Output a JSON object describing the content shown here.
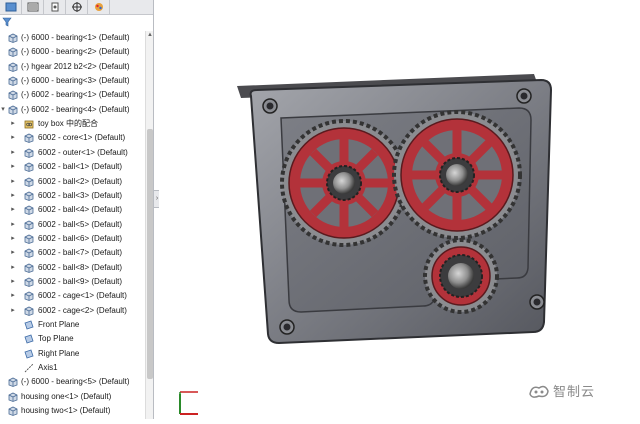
{
  "tree": {
    "items": [
      {
        "label": "(-) 6000 - bearing<1> (Default)",
        "icon": "part-icon",
        "level": 0,
        "arrow": ""
      },
      {
        "label": "(-) 6000 - bearing<2> (Default)",
        "icon": "part-icon",
        "level": 0,
        "arrow": ""
      },
      {
        "label": "(-) hgear 2012 b2<2> (Default)",
        "icon": "part-icon",
        "level": 0,
        "arrow": ""
      },
      {
        "label": "(-) 6000 - bearing<3> (Default)",
        "icon": "part-icon",
        "level": 0,
        "arrow": ""
      },
      {
        "label": "(-) 6002 - bearing<1> (Default)",
        "icon": "part-icon",
        "level": 0,
        "arrow": ""
      },
      {
        "label": "(-) 6002 - bearing<4> (Default)",
        "icon": "part-icon",
        "level": 0,
        "arrow": "v"
      },
      {
        "label": "toy box 中的配合",
        "icon": "mates-folder-icon",
        "level": 1,
        "arrow": ">"
      },
      {
        "label": "6002 - core<1> (Default)",
        "icon": "part-icon",
        "level": 1,
        "arrow": ">"
      },
      {
        "label": "6002 - outer<1> (Default)",
        "icon": "part-icon",
        "level": 1,
        "arrow": ">"
      },
      {
        "label": "6002 - ball<1> (Default)",
        "icon": "part-icon",
        "level": 1,
        "arrow": ">"
      },
      {
        "label": "6002 - ball<2> (Default)",
        "icon": "part-icon",
        "level": 1,
        "arrow": ">"
      },
      {
        "label": "6002 - ball<3> (Default)",
        "icon": "part-icon",
        "level": 1,
        "arrow": ">"
      },
      {
        "label": "6002 - ball<4> (Default)",
        "icon": "part-icon",
        "level": 1,
        "arrow": ">"
      },
      {
        "label": "6002 - ball<5> (Default)",
        "icon": "part-icon",
        "level": 1,
        "arrow": ">"
      },
      {
        "label": "6002 - ball<6> (Default)",
        "icon": "part-icon",
        "level": 1,
        "arrow": ">"
      },
      {
        "label": "6002 - ball<7> (Default)",
        "icon": "part-icon",
        "level": 1,
        "arrow": ">"
      },
      {
        "label": "6002 - ball<8> (Default)",
        "icon": "part-icon",
        "level": 1,
        "arrow": ">"
      },
      {
        "label": "6002 - ball<9> (Default)",
        "icon": "part-icon",
        "level": 1,
        "arrow": ">"
      },
      {
        "label": "6002 - cage<1> (Default)",
        "icon": "part-icon",
        "level": 1,
        "arrow": ">"
      },
      {
        "label": "6002 - cage<2> (Default)",
        "icon": "part-icon",
        "level": 1,
        "arrow": ">"
      },
      {
        "label": "Front Plane",
        "icon": "plane-icon",
        "level": 1,
        "arrow": ""
      },
      {
        "label": "Top Plane",
        "icon": "plane-icon",
        "level": 1,
        "arrow": ""
      },
      {
        "label": "Right Plane",
        "icon": "plane-icon",
        "level": 1,
        "arrow": ""
      },
      {
        "label": "Axis1",
        "icon": "axis-icon",
        "level": 1,
        "arrow": ""
      },
      {
        "label": "(-) 6000 - bearing<5> (Default)",
        "icon": "part-icon",
        "level": 0,
        "arrow": ""
      },
      {
        "label": "housing one<1> (Default)",
        "icon": "part-icon",
        "level": 0,
        "arrow": ""
      },
      {
        "label": "housing two<1> (Default)",
        "icon": "part-icon",
        "level": 0,
        "arrow": ""
      }
    ]
  },
  "watermark": {
    "text": "智制云"
  },
  "colors": {
    "gear_red": "#b3323a",
    "housing_gray": "#6f7078",
    "housing_light": "#9a9ca3",
    "tree_selected": "#dbe6f5"
  }
}
